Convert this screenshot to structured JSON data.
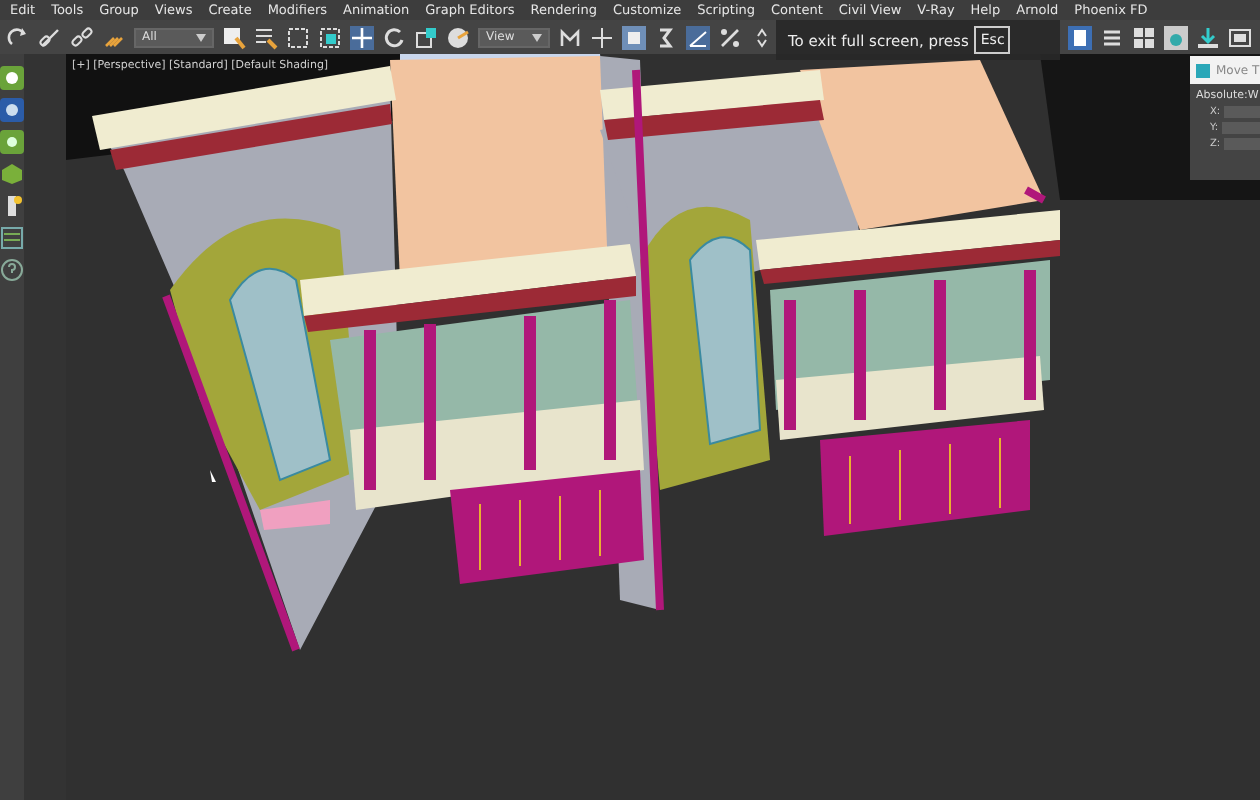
{
  "menu_bar": {
    "items": [
      "Edit",
      "Tools",
      "Group",
      "Views",
      "Create",
      "Modifiers",
      "Animation",
      "Graph Editors",
      "Rendering",
      "Customize",
      "Scripting",
      "Content",
      "Civil View",
      "V-Ray",
      "Help",
      "Arnold",
      "Phoenix FD"
    ]
  },
  "toolbar": {
    "selection_filter": "All",
    "reference_coord": "View"
  },
  "viewport": {
    "label": "[+] [Perspective] [Standard] [Default Shading]"
  },
  "fullscreen_notice": {
    "text": "To exit full screen, press",
    "key": "Esc"
  },
  "transform_panel": {
    "title": "Move T",
    "section": "Absolute:W",
    "axes": [
      "X:",
      "Y:",
      "Z:"
    ]
  }
}
